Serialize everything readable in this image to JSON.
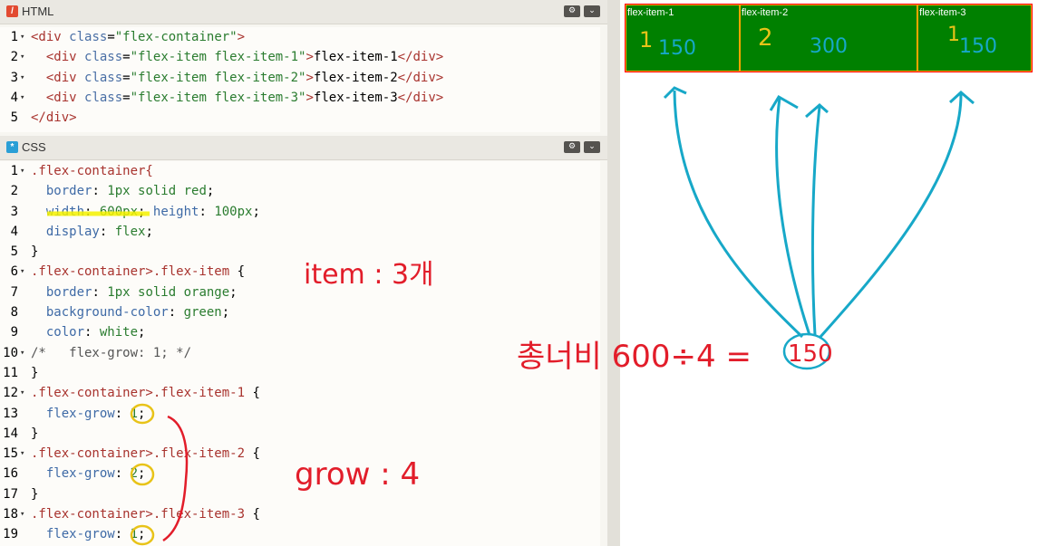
{
  "html_panel": {
    "title": "HTML",
    "settings_icon": "gear-icon",
    "collapse_icon": "chevron-down-icon",
    "lines": [
      {
        "n": "1",
        "fold": "▾",
        "parts": [
          [
            "tag",
            "<div "
          ],
          [
            "attr",
            "class"
          ],
          [
            "plain",
            "="
          ],
          [
            "str",
            "\"flex-container\""
          ],
          [
            "tag",
            ">"
          ]
        ]
      },
      {
        "n": "2",
        "fold": "▾",
        "parts": [
          [
            "plain",
            "  "
          ],
          [
            "tag",
            "<div "
          ],
          [
            "attr",
            "class"
          ],
          [
            "plain",
            "="
          ],
          [
            "str",
            "\"flex-item flex-item-1\""
          ],
          [
            "tag",
            ">"
          ],
          [
            "plain",
            "flex-item-1"
          ],
          [
            "tag",
            "</div>"
          ]
        ]
      },
      {
        "n": "3",
        "fold": "▾",
        "parts": [
          [
            "plain",
            "  "
          ],
          [
            "tag",
            "<div "
          ],
          [
            "attr",
            "class"
          ],
          [
            "plain",
            "="
          ],
          [
            "str",
            "\"flex-item flex-item-2\""
          ],
          [
            "tag",
            ">"
          ],
          [
            "plain",
            "flex-item-2"
          ],
          [
            "tag",
            "</div>"
          ]
        ]
      },
      {
        "n": "4",
        "fold": "▾",
        "parts": [
          [
            "plain",
            "  "
          ],
          [
            "tag",
            "<div "
          ],
          [
            "attr",
            "class"
          ],
          [
            "plain",
            "="
          ],
          [
            "str",
            "\"flex-item flex-item-3\""
          ],
          [
            "tag",
            ">"
          ],
          [
            "plain",
            "flex-item-3"
          ],
          [
            "tag",
            "</div>"
          ]
        ]
      },
      {
        "n": "5",
        "fold": "",
        "parts": [
          [
            "tag",
            "</div>"
          ]
        ]
      }
    ]
  },
  "css_panel": {
    "title": "CSS",
    "settings_icon": "gear-icon",
    "collapse_icon": "chevron-down-icon",
    "lines": [
      {
        "n": "1",
        "fold": "▾",
        "parts": [
          [
            "sel",
            ".flex-container{"
          ]
        ]
      },
      {
        "n": "2",
        "fold": "",
        "parts": [
          [
            "plain",
            "  "
          ],
          [
            "prop",
            "border"
          ],
          [
            "plain",
            ": "
          ],
          [
            "val",
            "1px solid red"
          ],
          [
            "plain",
            ";"
          ]
        ]
      },
      {
        "n": "3",
        "fold": "",
        "parts": [
          [
            "plain",
            "  "
          ],
          [
            "prop",
            "width"
          ],
          [
            "plain",
            ": "
          ],
          [
            "val",
            "600px"
          ],
          [
            "plain",
            "; "
          ],
          [
            "prop",
            "height"
          ],
          [
            "plain",
            ": "
          ],
          [
            "val",
            "100px"
          ],
          [
            "plain",
            ";"
          ]
        ]
      },
      {
        "n": "4",
        "fold": "",
        "parts": [
          [
            "plain",
            "  "
          ],
          [
            "prop",
            "display"
          ],
          [
            "plain",
            ": "
          ],
          [
            "val",
            "flex"
          ],
          [
            "plain",
            ";"
          ]
        ]
      },
      {
        "n": "5",
        "fold": "",
        "parts": [
          [
            "plain",
            "}"
          ]
        ]
      },
      {
        "n": "6",
        "fold": "▾",
        "parts": [
          [
            "sel",
            ".flex-container>.flex-item "
          ],
          [
            "plain",
            "{"
          ]
        ]
      },
      {
        "n": "7",
        "fold": "",
        "parts": [
          [
            "plain",
            "  "
          ],
          [
            "prop",
            "border"
          ],
          [
            "plain",
            ": "
          ],
          [
            "val",
            "1px solid orange"
          ],
          [
            "plain",
            ";"
          ]
        ]
      },
      {
        "n": "8",
        "fold": "",
        "parts": [
          [
            "plain",
            "  "
          ],
          [
            "prop",
            "background-color"
          ],
          [
            "plain",
            ": "
          ],
          [
            "val",
            "green"
          ],
          [
            "plain",
            ";"
          ]
        ]
      },
      {
        "n": "9",
        "fold": "",
        "parts": [
          [
            "plain",
            "  "
          ],
          [
            "prop",
            "color"
          ],
          [
            "plain",
            ": "
          ],
          [
            "val",
            "white"
          ],
          [
            "plain",
            ";"
          ]
        ]
      },
      {
        "n": "10",
        "fold": "▾",
        "parts": [
          [
            "cmt",
            "/*   flex-grow: 1; */"
          ]
        ]
      },
      {
        "n": "11",
        "fold": "",
        "parts": [
          [
            "plain",
            "}"
          ]
        ]
      },
      {
        "n": "12",
        "fold": "▾",
        "parts": [
          [
            "sel",
            ".flex-container>.flex-item-1 "
          ],
          [
            "plain",
            "{"
          ]
        ]
      },
      {
        "n": "13",
        "fold": "",
        "parts": [
          [
            "plain",
            "  "
          ],
          [
            "prop",
            "flex-grow"
          ],
          [
            "plain",
            ": "
          ],
          [
            "val",
            "1"
          ],
          [
            "plain",
            ";"
          ]
        ]
      },
      {
        "n": "14",
        "fold": "",
        "parts": [
          [
            "plain",
            "}"
          ]
        ]
      },
      {
        "n": "15",
        "fold": "▾",
        "parts": [
          [
            "sel",
            ".flex-container>.flex-item-2 "
          ],
          [
            "plain",
            "{"
          ]
        ]
      },
      {
        "n": "16",
        "fold": "",
        "parts": [
          [
            "plain",
            "  "
          ],
          [
            "prop",
            "flex-grow"
          ],
          [
            "plain",
            ": "
          ],
          [
            "val",
            "2"
          ],
          [
            "plain",
            ";"
          ]
        ]
      },
      {
        "n": "17",
        "fold": "",
        "parts": [
          [
            "plain",
            "}"
          ]
        ]
      },
      {
        "n": "18",
        "fold": "▾",
        "parts": [
          [
            "sel",
            ".flex-container>.flex-item-3 "
          ],
          [
            "plain",
            "{"
          ]
        ]
      },
      {
        "n": "19",
        "fold": "",
        "parts": [
          [
            "plain",
            "  "
          ],
          [
            "prop",
            "flex-grow"
          ],
          [
            "plain",
            ": "
          ],
          [
            "val",
            "1"
          ],
          [
            "plain",
            ";"
          ]
        ]
      }
    ]
  },
  "preview": {
    "items": [
      {
        "label": "flex-item-1",
        "grow": 1
      },
      {
        "label": "flex-item-2",
        "grow": 2
      },
      {
        "label": "flex-item-3",
        "grow": 1
      }
    ]
  },
  "annotations": {
    "item_note": "item : 3개",
    "grow_note": "grow : 4",
    "total_note": "총너비 600÷4 =",
    "circled_value": "150",
    "item_grow_marks": [
      "1",
      "2",
      "1"
    ],
    "item_width_marks": [
      "150",
      "300",
      "150"
    ],
    "colors": {
      "red": "#e21d2a",
      "yellow": "#e8c318",
      "blue": "#17a8c8",
      "highlight": "#f5f200"
    }
  }
}
